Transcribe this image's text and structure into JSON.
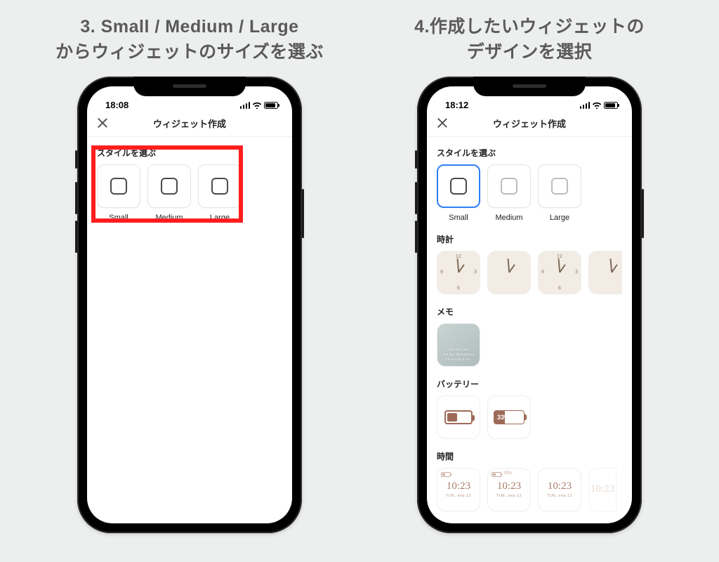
{
  "left": {
    "caption_line1": "3. Small / Medium / Large",
    "caption_line2": "からウィジェットのサイズを選ぶ",
    "time": "18:08",
    "header_title": "ウィジェット作成",
    "section_style": "スタイルを選ぶ",
    "sizes": [
      {
        "label": "Small"
      },
      {
        "label": "Medium"
      },
      {
        "label": "Large"
      }
    ]
  },
  "right": {
    "caption_line1": "4.作成したいウィジェットの",
    "caption_line2": "デザインを選択",
    "time": "18:12",
    "header_title": "ウィジェット作成",
    "section_style": "スタイルを選ぶ",
    "sizes": [
      {
        "label": "Small",
        "selected": true
      },
      {
        "label": "Medium"
      },
      {
        "label": "Large"
      }
    ],
    "sections": {
      "clock": "時計",
      "memo": "メモ",
      "battery": "バッテリー",
      "time": "時間"
    },
    "memo_lines": [
      "your text here.",
      "You like Michaelism.",
      "I'm loving it too."
    ],
    "battery_pct": "33%",
    "time_widget": {
      "time": "10:23",
      "date": "TUE, sep.12",
      "batt_pct": "33%"
    }
  }
}
